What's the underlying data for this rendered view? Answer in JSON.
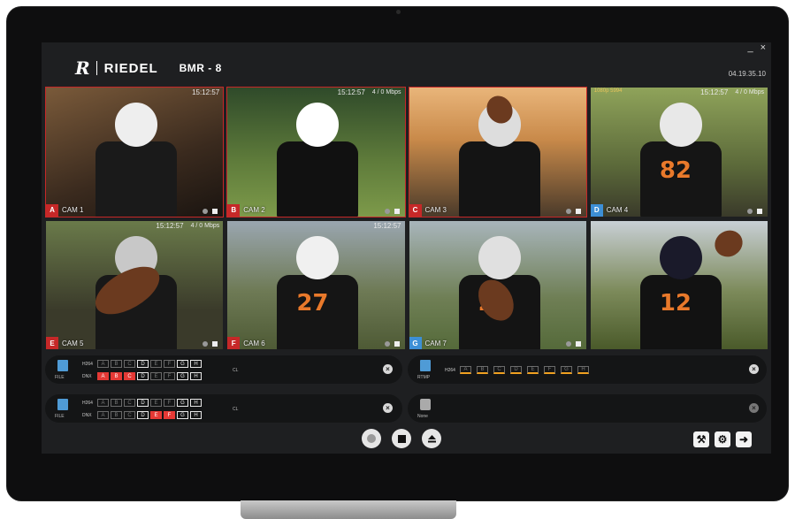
{
  "window": {
    "minimize": "_",
    "close": "×"
  },
  "brand": {
    "mark": "R",
    "name": "RIEDEL",
    "product": "BMR - 8"
  },
  "version": "04.19.35.10",
  "tiles": [
    {
      "letter": "A",
      "name": "CAM 1",
      "color": "#c62828",
      "recording": true,
      "timecode": "15:12:57",
      "bitrate": "",
      "format": "",
      "icon": "square"
    },
    {
      "letter": "B",
      "name": "CAM 2",
      "color": "#c62828",
      "recording": true,
      "timecode": "15:12:57",
      "bitrate": "4 / 0 Mbps",
      "format": "",
      "icon": "square"
    },
    {
      "letter": "C",
      "name": "CAM 3",
      "color": "#c62828",
      "recording": true,
      "timecode": "",
      "bitrate": "",
      "format": "",
      "icon": "square"
    },
    {
      "letter": "D",
      "name": "CAM 4",
      "color": "#3d8fd6",
      "recording": false,
      "timecode": "15:12:57",
      "bitrate": "4 / 0 Mbps",
      "format": "1080p 5994",
      "icon": "square"
    },
    {
      "letter": "E",
      "name": "CAM 5",
      "color": "#c62828",
      "recording": false,
      "timecode": "15:12:57",
      "bitrate": "4 / 0 Mbps",
      "format": "",
      "icon": "square"
    },
    {
      "letter": "F",
      "name": "CAM 6",
      "color": "#c62828",
      "recording": false,
      "timecode": "15:12:57",
      "bitrate": "",
      "format": "",
      "icon": "square"
    },
    {
      "letter": "G",
      "name": "CAM 7",
      "color": "#3d8fd6",
      "recording": false,
      "timecode": "",
      "bitrate": "",
      "format": "",
      "icon": "square"
    },
    {
      "letter": "",
      "name": "",
      "color": "",
      "recording": false,
      "timecode": "",
      "bitrate": "",
      "format": "",
      "icon": ""
    }
  ],
  "recorders": [
    {
      "target": "FILE",
      "codecs": [
        {
          "name": "H264",
          "boxes": [
            "A",
            "B",
            "C",
            "D",
            "E",
            "F",
            "G",
            "H"
          ],
          "state": [
            "off",
            "off",
            "off",
            "on",
            "off",
            "off",
            "on",
            "on"
          ]
        },
        {
          "name": "DNX",
          "boxes": [
            "A",
            "B",
            "C",
            "D",
            "E",
            "F",
            "G",
            "H"
          ],
          "state": [
            "red",
            "red",
            "red",
            "on",
            "off",
            "off",
            "on",
            "on"
          ]
        }
      ],
      "ch_label": "CL"
    },
    {
      "target": "RTMP",
      "codecs": [
        {
          "name": "H264",
          "boxes": [
            "A",
            "B",
            "C",
            "D",
            "E",
            "F",
            "G",
            "H"
          ],
          "state": [
            "tick",
            "tick",
            "tick",
            "tick",
            "tick",
            "tick",
            "tick",
            "tick"
          ]
        }
      ],
      "ch_label": ""
    },
    {
      "target": "FILE",
      "codecs": [
        {
          "name": "H264",
          "boxes": [
            "A",
            "B",
            "C",
            "D",
            "E",
            "F",
            "G",
            "H"
          ],
          "state": [
            "off",
            "off",
            "off",
            "on",
            "off",
            "off",
            "on",
            "on"
          ]
        },
        {
          "name": "DNX",
          "boxes": [
            "A",
            "B",
            "C",
            "D",
            "E",
            "F",
            "G",
            "H"
          ],
          "state": [
            "off",
            "off",
            "off",
            "on",
            "red",
            "red",
            "on",
            "on"
          ]
        }
      ],
      "ch_label": "CL"
    },
    {
      "target": "None",
      "codecs": [],
      "ch_label": ""
    }
  ],
  "transport": {
    "record": "record-icon",
    "stop": "stop-icon",
    "eject": "eject-icon"
  },
  "tools": [
    "tools-icon",
    "settings-icon",
    "exit-icon"
  ]
}
